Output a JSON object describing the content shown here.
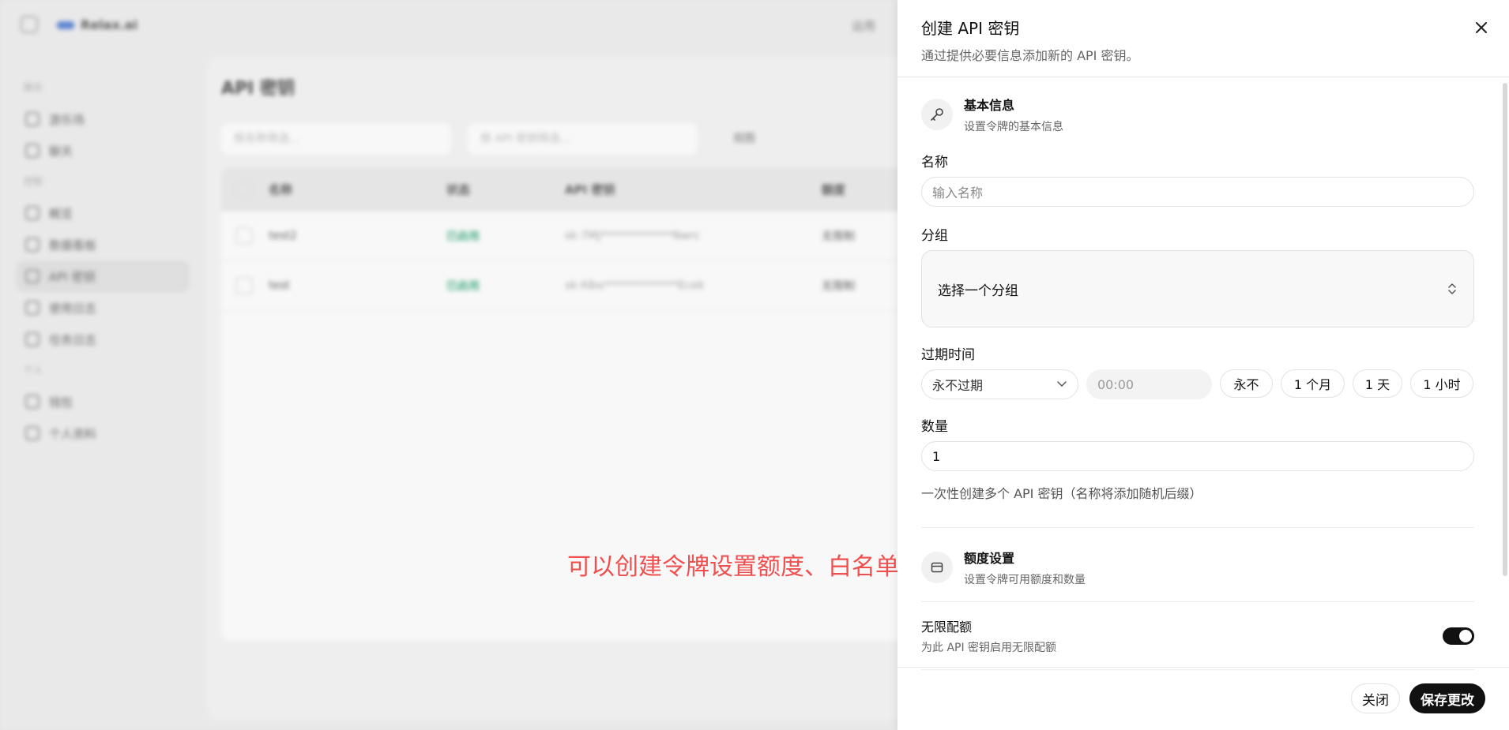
{
  "background": {
    "brand": "Relax.ai",
    "topright": "运用",
    "sidebar": {
      "sections": [
        {
          "title": "聊天",
          "items": [
            "游乐场",
            "聊天"
          ]
        },
        {
          "title": "控制",
          "items": [
            "概览",
            "数据看板",
            "API 密钥",
            "使用日志",
            "任务日志"
          ]
        },
        {
          "title": "个人",
          "items": [
            "钱包",
            "个人资料"
          ]
        }
      ],
      "active_item": "API 密钥"
    },
    "page_title": "API 密钥",
    "filters": {
      "name_placeholder": "按名称筛选...",
      "key_placeholder": "按 API 密钥筛选...",
      "view_label": "视图"
    },
    "table": {
      "columns": [
        "名称",
        "状态",
        "API 密钥",
        "额度"
      ],
      "rows": [
        {
          "name": "test2",
          "status": "已启用",
          "key": "sk-7Mj*************Nwrc",
          "quota": "无限制"
        },
        {
          "name": "test",
          "status": "已启用",
          "key": "sk-X8xr*************Ecek",
          "quota": "无限制"
        }
      ]
    }
  },
  "annotation": "可以创建令牌设置额度、白名单",
  "drawer": {
    "title": "创建 API 密钥",
    "description": "通过提供必要信息添加新的 API 密钥。",
    "basic": {
      "title": "基本信息",
      "subtitle": "设置令牌的基本信息"
    },
    "name": {
      "label": "名称",
      "placeholder": "输入名称"
    },
    "group": {
      "label": "分组",
      "value": "选择一个分组"
    },
    "expiry": {
      "label": "过期时间",
      "select_value": "永不过期",
      "time_placeholder": "00:00",
      "quick": [
        "永不",
        "1 个月",
        "1 天",
        "1 小时"
      ]
    },
    "quantity": {
      "label": "数量",
      "value": "1",
      "help": "一次性创建多个 API 密钥（名称将添加随机后缀）"
    },
    "quota": {
      "title": "额度设置",
      "subtitle": "设置令牌可用额度和数量"
    },
    "unlimited": {
      "label": "无限配额",
      "help": "为此 API 密钥启用无限配额",
      "enabled": true
    },
    "buttons": {
      "close": "关闭",
      "save": "保存更改"
    }
  },
  "colors": {
    "annotation": "#ef4f4f",
    "primary": "#111111",
    "status_green": "#22a06b"
  }
}
